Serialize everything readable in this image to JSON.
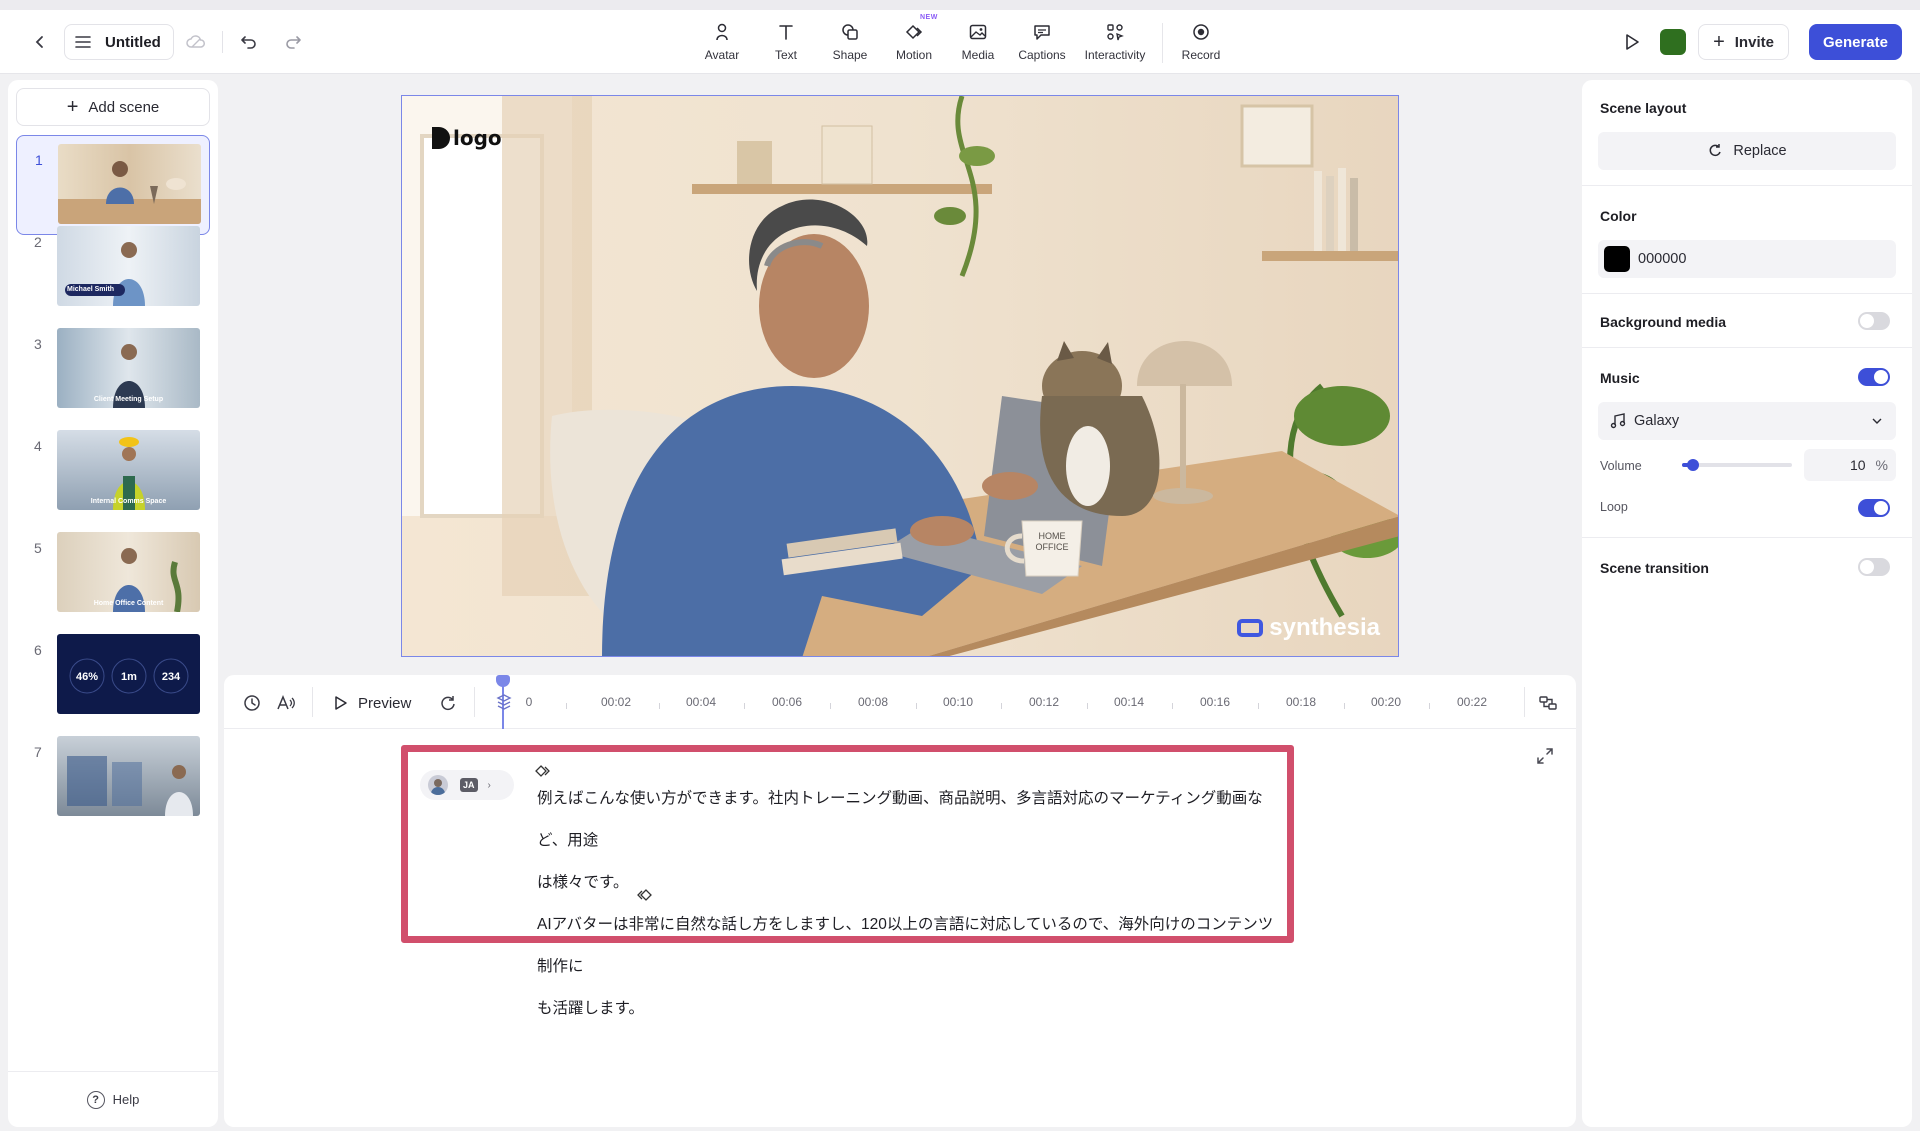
{
  "header": {
    "title": "Untitled",
    "tools": [
      {
        "label": "Avatar",
        "icon": "avatar-icon"
      },
      {
        "label": "Text",
        "icon": "text-icon"
      },
      {
        "label": "Shape",
        "icon": "shape-icon"
      },
      {
        "label": "Motion",
        "icon": "motion-icon",
        "badge": "NEW"
      },
      {
        "label": "Media",
        "icon": "media-icon"
      },
      {
        "label": "Captions",
        "icon": "captions-icon"
      },
      {
        "label": "Interactivity",
        "icon": "interactivity-icon"
      },
      {
        "label": "Record",
        "icon": "record-icon"
      }
    ],
    "brand_color": "#2f6f1f",
    "invite_label": "Invite",
    "generate_label": "Generate",
    "accent": "#3d4fd8"
  },
  "scenes": {
    "add_label": "Add scene",
    "items": [
      {
        "num": "1",
        "caption": ""
      },
      {
        "num": "2",
        "caption": "Michael Smith"
      },
      {
        "num": "3",
        "caption": "Client Meeting Setup"
      },
      {
        "num": "4",
        "caption": "Internal Comms Space"
      },
      {
        "num": "5",
        "caption": "Home Office Content"
      },
      {
        "num": "6",
        "caption": "",
        "stats": [
          "46%",
          "1m",
          "234"
        ]
      },
      {
        "num": "7",
        "caption": ""
      }
    ],
    "help_label": "Help"
  },
  "canvas": {
    "logo_text": "logo",
    "watermark": "synthesia",
    "mug_text": "HOME\nOFFICE"
  },
  "timeline": {
    "preview_label": "Preview",
    "ticks": [
      "0",
      "00:02",
      "00:04",
      "00:06",
      "00:08",
      "00:10",
      "00:12",
      "00:14",
      "00:16",
      "00:18",
      "00:20",
      "00:22"
    ]
  },
  "script": {
    "lang": "JA",
    "lines": [
      "例えばこんな使い方ができます。社内トレーニング動画、商品説明、多言語対応のマーケティング動画など、用途",
      "は様々です。",
      "AIアバターは非常に自然な話し方をしますし、120以上の言語に対応しているので、海外向けのコンテンツ制作に",
      "も活躍します。"
    ]
  },
  "right_panel": {
    "scene_layout_label": "Scene layout",
    "replace_label": "Replace",
    "color_label": "Color",
    "color_value": "000000",
    "background_media_label": "Background media",
    "background_media_on": false,
    "music_label": "Music",
    "music_on": true,
    "music_track": "Galaxy",
    "volume_label": "Volume",
    "volume_value": "10",
    "volume_unit": "%",
    "volume_fraction": 0.1,
    "loop_label": "Loop",
    "loop_on": true,
    "scene_transition_label": "Scene transition",
    "scene_transition_on": false
  }
}
